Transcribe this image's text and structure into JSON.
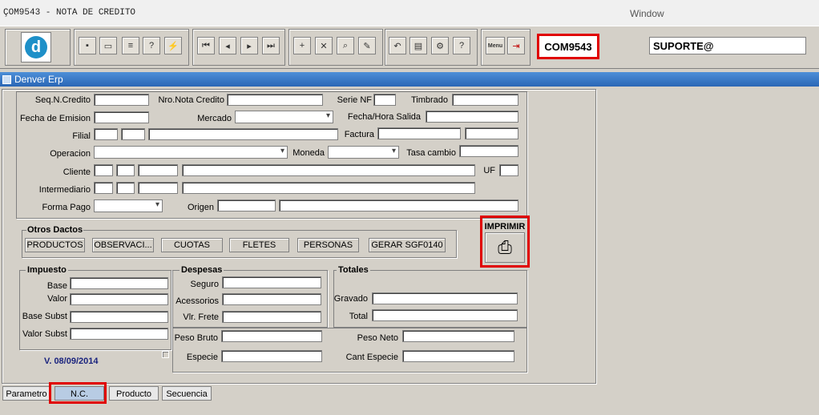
{
  "window": {
    "title": "ÇOM9543 - NOTA DE CREDITO",
    "menu": "Window"
  },
  "toolbar": {
    "form_code": "COM9543",
    "user": "SUPORTE@",
    "logo_letter": "d",
    "menu_label": "Menu"
  },
  "app_bar": {
    "title": "Denver Erp"
  },
  "form": {
    "seq_label": "Seq.N.Credito",
    "nro_label": "Nro.Nota Credito",
    "serie_label": "Serie NF",
    "timbrado_label": "Timbrado",
    "fecha_emision_label": "Fecha de Emision",
    "mercado_label": "Mercado",
    "fecha_salida_label": "Fecha/Hora Salida",
    "filial_label": "Filial",
    "factura_label": "Factura",
    "operacion_label": "Operacion",
    "moneda_label": "Moneda",
    "tasa_label": "Tasa cambio",
    "cliente_label": "Cliente",
    "uf_label": "UF",
    "intermediario_label": "Intermediario",
    "forma_pago_label": "Forma Pago",
    "origen_label": "Origen"
  },
  "otros": {
    "title": "Otros Dactos",
    "buttons": [
      "PRODUCTOS",
      "OBSERVACI...",
      "CUOTAS",
      "FLETES",
      "PERSONAS",
      "GERAR SGF0140"
    ]
  },
  "imprimir": {
    "label": "IMPRIMIR"
  },
  "impuesto": {
    "title": "Impuesto",
    "base": "Base",
    "valor": "Valor",
    "base_subst": "Base Subst",
    "valor_subst": "Valor Subst"
  },
  "despesas": {
    "title": "Despesas",
    "seguro": "Seguro",
    "acessorios": "Acessorios",
    "vlr_frete": "Vlr. Frete"
  },
  "totales": {
    "title": "Totales",
    "gravado": "Gravado",
    "total": "Total"
  },
  "peso": {
    "bruto": "Peso Bruto",
    "neto": "Peso Neto",
    "especie": "Especie",
    "cant_especie": "Cant Especie"
  },
  "version": "V. 08/09/2014",
  "tabs": [
    "Parametro",
    "N.C.",
    "Producto",
    "Secuencia"
  ],
  "colors": {
    "highlight": "#e00000",
    "title_bar": "#2a66b5",
    "version_text": "#1a237e"
  }
}
